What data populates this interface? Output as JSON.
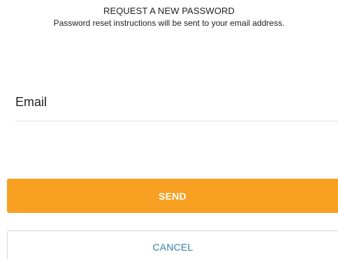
{
  "header": {
    "title": "REQUEST A NEW PASSWORD",
    "subtitle": "Password reset instructions will be sent to your email address."
  },
  "form": {
    "email": {
      "placeholder": "Email",
      "value": ""
    },
    "send_label": "SEND",
    "cancel_label": "CANCEL"
  },
  "colors": {
    "primary": "#f7a021",
    "link": "#2f7fa8",
    "text": "#222222",
    "divider": "#e3e3e3"
  }
}
